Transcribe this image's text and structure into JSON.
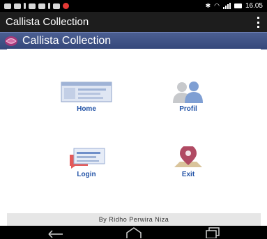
{
  "status_bar": {
    "time": "16.05"
  },
  "app_bar": {
    "title": "Callista Collection",
    "menu_icon": "overflow-menu-icon"
  },
  "banner": {
    "title": "Callista Collection",
    "logo_icon": "callista-logo-icon"
  },
  "menu": {
    "home": {
      "label": "Home",
      "icon": "home-icon"
    },
    "profil": {
      "label": "Profil",
      "icon": "profile-users-icon"
    },
    "login": {
      "label": "Login",
      "icon": "login-chat-icon"
    },
    "exit": {
      "label": "Exit",
      "icon": "map-pin-icon"
    }
  },
  "footer": {
    "credit": "By Ridho Perwira Niza"
  },
  "colors": {
    "banner": "#3e5189",
    "label": "#2152a6",
    "appbar": "#1d1d1d"
  }
}
